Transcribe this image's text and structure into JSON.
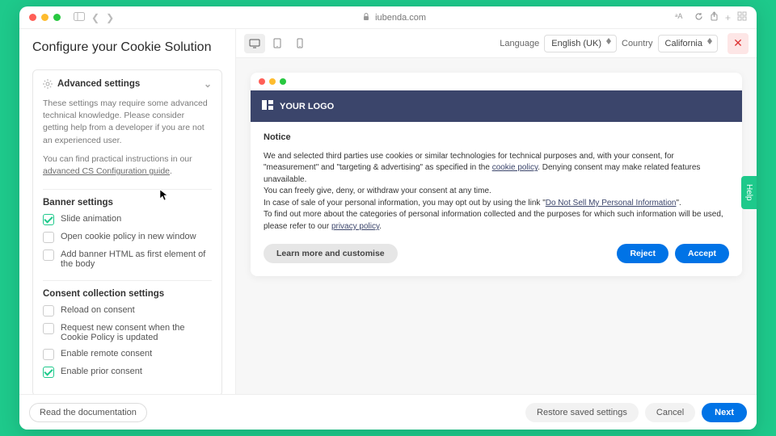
{
  "browser": {
    "address": "iubenda.com"
  },
  "sidebar": {
    "title": "Configure your Cookie Solution",
    "advanced": {
      "heading": "Advanced settings",
      "desc1": "These settings may require some advanced technical knowledge. Please consider getting help from a developer if you are not an experienced user.",
      "desc2_pre": "You can find practical instructions in our ",
      "desc2_link": "advanced CS Configuration guide",
      "desc2_post": "."
    },
    "banner_section": {
      "title": "Banner settings",
      "items": [
        {
          "label": "Slide animation",
          "checked": true
        },
        {
          "label": "Open cookie policy in new window",
          "checked": false
        },
        {
          "label": "Add banner HTML as first element of the body",
          "checked": false
        }
      ]
    },
    "consent_section": {
      "title": "Consent collection settings",
      "items": [
        {
          "label": "Reload on consent",
          "checked": false
        },
        {
          "label": "Request new consent when the Cookie Policy is updated",
          "checked": false
        },
        {
          "label": "Enable remote consent",
          "checked": false
        },
        {
          "label": "Enable prior consent",
          "checked": true
        }
      ]
    }
  },
  "toolbar": {
    "language_label": "Language",
    "language_value": "English (UK)",
    "country_label": "Country",
    "country_value": "California"
  },
  "banner": {
    "logo_text": "YOUR LOGO",
    "notice_title": "Notice",
    "p1": "We and selected third parties use cookies or similar technologies for technical purposes and, with your consent, for \"measurement\" and \"targeting & advertising\" as specified in the ",
    "p1_link": "cookie policy",
    "p1_post": ". Denying consent may make related features unavailable.",
    "p2": "You can freely give, deny, or withdraw your consent at any time.",
    "p3_pre": "In case of sale of your personal information, you may opt out by using the link \"",
    "p3_link": "Do Not Sell My Personal Information",
    "p3_post": "\".",
    "p4_pre": "To find out more about the categories of personal information collected and the purposes for which such information will be used, please refer to our ",
    "p4_link": "privacy policy",
    "p4_post": ".",
    "learn_more": "Learn more and customise",
    "reject": "Reject",
    "accept": "Accept"
  },
  "footer": {
    "docs": "Read the documentation",
    "restore": "Restore saved settings",
    "cancel": "Cancel",
    "next": "Next"
  },
  "help": "Help"
}
